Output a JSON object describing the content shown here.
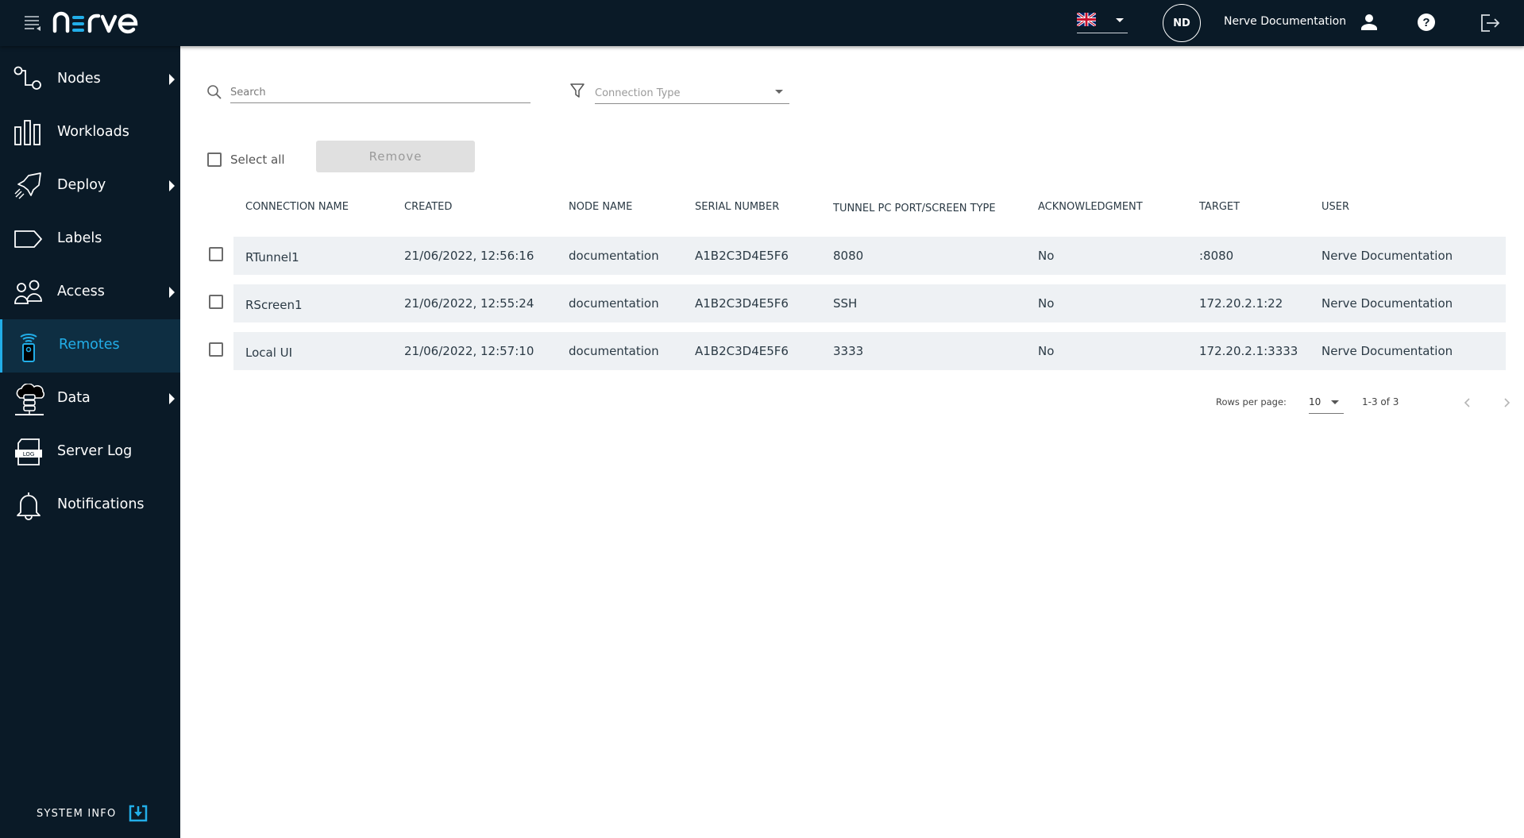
{
  "app": {
    "brand": "nerve",
    "brand_accent_color": "#22aee8",
    "sidebar_bg": "#0a1a27",
    "active_bg": "#0e2e42"
  },
  "header": {
    "language": "English (UK)",
    "language_icon": "uk-flag-icon",
    "avatar_initials": "ND",
    "username": "Nerve Documentation",
    "icons": [
      "user-icon",
      "help-icon",
      "logout-icon"
    ]
  },
  "sidebar": {
    "items": [
      {
        "label": "Nodes",
        "icon": "nodes-icon",
        "has_submenu": true,
        "active": false
      },
      {
        "label": "Workloads",
        "icon": "workloads-icon",
        "has_submenu": false,
        "active": false
      },
      {
        "label": "Deploy",
        "icon": "rocket-icon",
        "has_submenu": true,
        "active": false
      },
      {
        "label": "Labels",
        "icon": "label-icon",
        "has_submenu": false,
        "active": false
      },
      {
        "label": "Access",
        "icon": "users-icon",
        "has_submenu": true,
        "active": false
      },
      {
        "label": "Remotes",
        "icon": "remote-icon",
        "has_submenu": false,
        "active": true
      },
      {
        "label": "Data",
        "icon": "cloud-database-icon",
        "has_submenu": true,
        "active": false
      },
      {
        "label": "Server Log",
        "icon": "log-file-icon",
        "has_submenu": false,
        "active": false
      },
      {
        "label": "Notifications",
        "icon": "bell-icon",
        "has_submenu": false,
        "active": false
      }
    ],
    "system_info_label": "SYSTEM INFO"
  },
  "toolbar": {
    "search_placeholder": "Search",
    "search_value": "",
    "filter_placeholder": "Connection Type",
    "select_all_label": "Select all",
    "remove_label": "Remove"
  },
  "table": {
    "columns": [
      "CONNECTION NAME",
      "CREATED",
      "NODE NAME",
      "SERIAL NUMBER",
      "TUNNEL PC PORT/SCREEN TYPE",
      "ACKNOWLEDGMENT",
      "TARGET",
      "USER"
    ],
    "rows": [
      [
        "RTunnel1",
        "21/06/2022, 12:56:16",
        "documentation",
        "A1B2C3D4E5F6",
        "8080",
        "No",
        ":8080",
        "Nerve Documentation"
      ],
      [
        "RScreen1",
        "21/06/2022, 12:55:24",
        "documentation",
        "A1B2C3D4E5F6",
        "SSH",
        "No",
        "172.20.2.1:22",
        "Nerve Documentation"
      ],
      [
        "Local UI",
        "21/06/2022, 12:57:10",
        "documentation",
        "A1B2C3D4E5F6",
        "3333",
        "No",
        "172.20.2.1:3333",
        "Nerve Documentation"
      ]
    ]
  },
  "pagination": {
    "rows_per_page_label": "Rows per page:",
    "rows_per_page": "10",
    "range": "1-3 of 3"
  }
}
